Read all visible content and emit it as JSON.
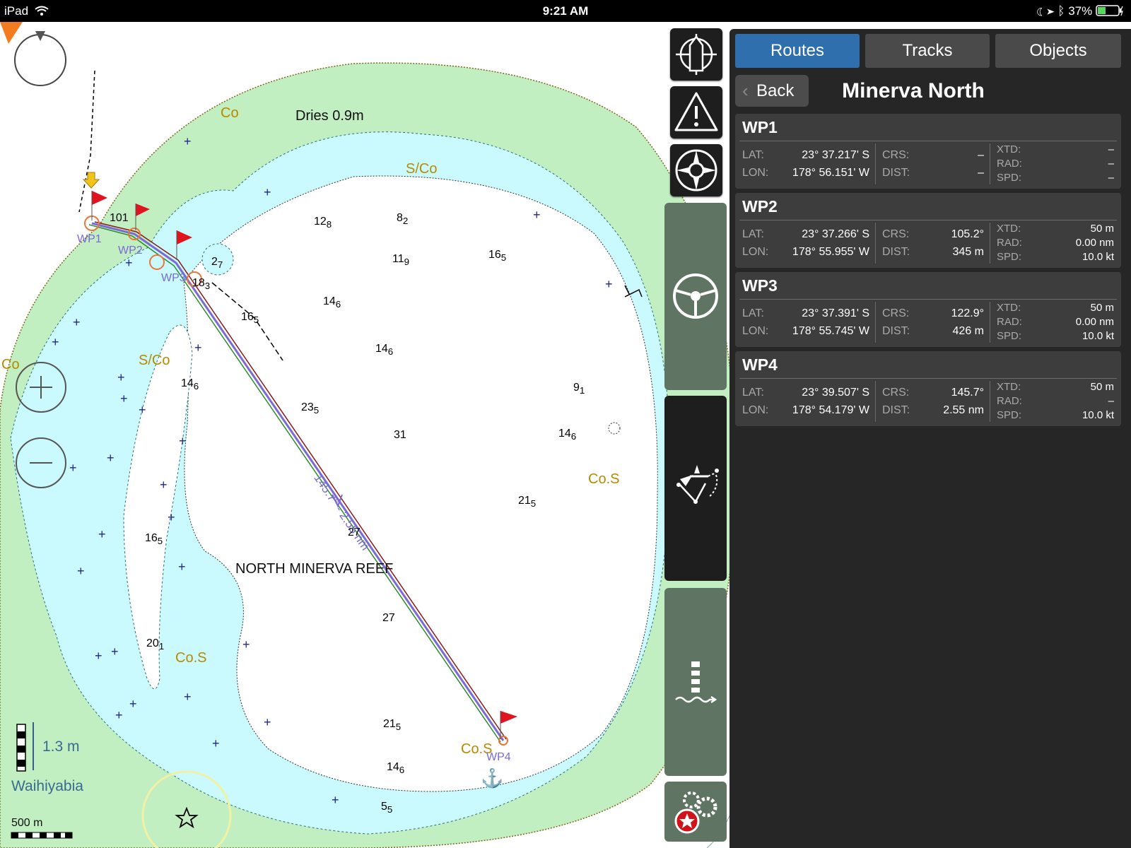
{
  "status": {
    "device": "iPad",
    "time": "9:21 AM",
    "battery": "37%",
    "icons": [
      "wifi-icon",
      "moon-icon",
      "location-arrow-icon",
      "bluetooth-icon",
      "battery-icon"
    ]
  },
  "map": {
    "labels": {
      "dries": "Dries 0.9m",
      "co_top": "Co",
      "sco_top": "S/Co",
      "sco_left": "S/Co",
      "co_left": "Co",
      "cos_right": "Co.S",
      "cos_left": "Co.S",
      "cos_bottom": "Co.S",
      "reef_name": "NORTH MINERVA REEF",
      "route_leg": "145.7° - 2.55 nm",
      "tide_height": "1.3 m",
      "tide_station": "Waihiyabia",
      "scale": "500 m"
    },
    "depths": [
      {
        "main": "12",
        "sub": "8"
      },
      {
        "main": "8",
        "sub": "2"
      },
      {
        "main": "11",
        "sub": "9"
      },
      {
        "main": "16",
        "sub": "5"
      },
      {
        "main": "2",
        "sub": "7"
      },
      {
        "main": "14",
        "sub": "6"
      },
      {
        "main": "16",
        "sub": "5"
      },
      {
        "main": "14",
        "sub": "6"
      },
      {
        "main": "14",
        "sub": "6"
      },
      {
        "main": "23",
        "sub": "5"
      },
      {
        "main": "31",
        "sub": ""
      },
      {
        "main": "9",
        "sub": "1"
      },
      {
        "main": "14",
        "sub": "6"
      },
      {
        "main": "21",
        "sub": "5"
      },
      {
        "main": "16",
        "sub": "5"
      },
      {
        "main": "27",
        "sub": ""
      },
      {
        "main": "27",
        "sub": ""
      },
      {
        "main": "20",
        "sub": "1"
      },
      {
        "main": "21",
        "sub": "5"
      },
      {
        "main": "14",
        "sub": "6"
      },
      {
        "main": "5",
        "sub": "5"
      },
      {
        "main": "101",
        "sub": ""
      },
      {
        "main": "18",
        "sub": "3"
      }
    ],
    "waypoint_labels": [
      "WP1",
      "WP2",
      "WP3",
      "WP4"
    ]
  },
  "toolbar": {
    "buttons": [
      "center-boat-icon",
      "warning-icon",
      "compass-rose-icon",
      "helm-wheel-icon",
      "route-planning-icon",
      "tide-station-icon",
      "settings-gears-icon"
    ]
  },
  "panel": {
    "tabs": [
      "Routes",
      "Tracks",
      "Objects"
    ],
    "active_tab": "Routes",
    "back_label": "Back",
    "title": "Minerva North",
    "field_labels": {
      "lat": "LAT:",
      "lon": "LON:",
      "crs": "CRS:",
      "dist": "DIST:",
      "xtd": "XTD:",
      "rad": "RAD:",
      "spd": "SPD:"
    },
    "waypoints": [
      {
        "name": "WP1",
        "lat": "23° 37.217' S",
        "lon": "178° 56.151' W",
        "crs": "–",
        "dist": "–",
        "xtd": "–",
        "rad": "–",
        "spd": "–"
      },
      {
        "name": "WP2",
        "lat": "23° 37.266' S",
        "lon": "178° 55.955' W",
        "crs": "105.2°",
        "dist": "345 m",
        "xtd": "50 m",
        "rad": "0.00 nm",
        "spd": "10.0 kt"
      },
      {
        "name": "WP3",
        "lat": "23° 37.391' S",
        "lon": "178° 55.745' W",
        "crs": "122.9°",
        "dist": "426 m",
        "xtd": "50 m",
        "rad": "0.00 nm",
        "spd": "10.0 kt"
      },
      {
        "name": "WP4",
        "lat": "23° 39.507' S",
        "lon": "178° 54.179' W",
        "crs": "145.7°",
        "dist": "2.55 nm",
        "xtd": "50 m",
        "rad": "–",
        "spd": "10.0 kt"
      }
    ]
  }
}
